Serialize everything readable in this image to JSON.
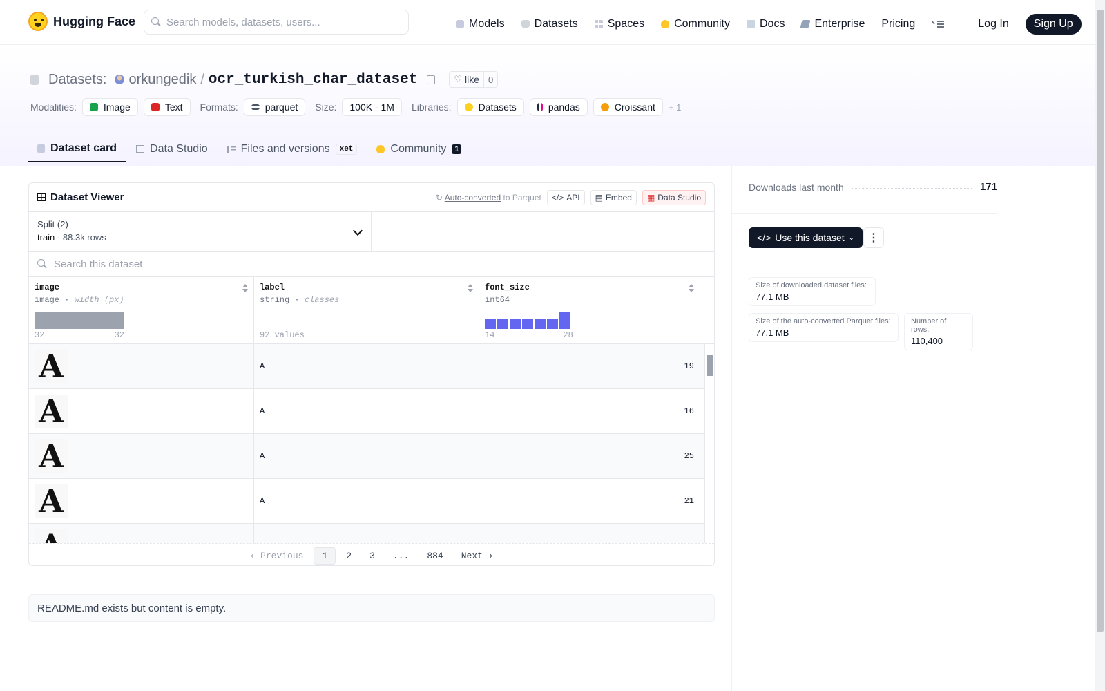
{
  "header": {
    "brand": "Hugging Face",
    "search_placeholder": "Search models, datasets, users...",
    "nav": [
      "Models",
      "Datasets",
      "Spaces",
      "Community",
      "Docs",
      "Enterprise",
      "Pricing"
    ],
    "login": "Log In",
    "signup": "Sign Up"
  },
  "repo": {
    "type_label": "Datasets:",
    "owner": "orkungedik",
    "sep": "/",
    "name": "ocr_turkish_char_dataset",
    "like_label": "like",
    "like_count": "0"
  },
  "tags": {
    "modalities_label": "Modalities:",
    "modalities": [
      "Image",
      "Text"
    ],
    "formats_label": "Formats:",
    "formats": [
      "parquet"
    ],
    "size_label": "Size:",
    "size": "100K - 1M",
    "libraries_label": "Libraries:",
    "libraries": [
      "Datasets",
      "pandas",
      "Croissant"
    ],
    "more": "+ 1"
  },
  "tabs": {
    "card": "Dataset card",
    "studio": "Data Studio",
    "files": "Files and versions",
    "xet": "xet",
    "community": "Community",
    "community_count": "1"
  },
  "viewer": {
    "title": "Dataset Viewer",
    "auto_converted": "Auto-converted",
    "to_parquet": "to Parquet",
    "api": "API",
    "embed": "Embed",
    "data_studio": "Data Studio",
    "split_label": "Split (2)",
    "split_name": "train",
    "split_rows": "88.3k rows",
    "search_placeholder": "Search this dataset",
    "columns": [
      {
        "name": "image",
        "type": "image",
        "sub": "width (px)",
        "min": "32",
        "max": "32"
      },
      {
        "name": "label",
        "type": "string",
        "sub": "classes",
        "values": "92 values"
      },
      {
        "name": "font_size",
        "type": "int64",
        "min": "14",
        "max": "28",
        "hist": [
          0.6,
          0.6,
          0.6,
          0.6,
          0.6,
          0.6,
          1.0
        ]
      }
    ],
    "rows": [
      {
        "glyph": "A",
        "label": "A",
        "font_size": "19"
      },
      {
        "glyph": "A",
        "label": "A",
        "font_size": "16"
      },
      {
        "glyph": "A",
        "label": "A",
        "font_size": "25"
      },
      {
        "glyph": "A",
        "label": "A",
        "font_size": "21"
      },
      {
        "glyph": "A",
        "label": "",
        "font_size": ""
      }
    ],
    "pager": {
      "prev": "Previous",
      "pages": [
        "1",
        "2",
        "3",
        "...",
        "884"
      ],
      "next": "Next"
    }
  },
  "readme_text": "README.md exists but content is empty.",
  "sidebar": {
    "downloads_label": "Downloads last month",
    "downloads": "171",
    "use_dataset": "Use this dataset",
    "stats": [
      {
        "k": "Size of downloaded dataset files:",
        "v": "77.1 MB"
      },
      {
        "k": "Size of the auto-converted Parquet files:",
        "v": "77.1 MB"
      },
      {
        "k": "Number of rows:",
        "v": "110,400"
      }
    ]
  }
}
